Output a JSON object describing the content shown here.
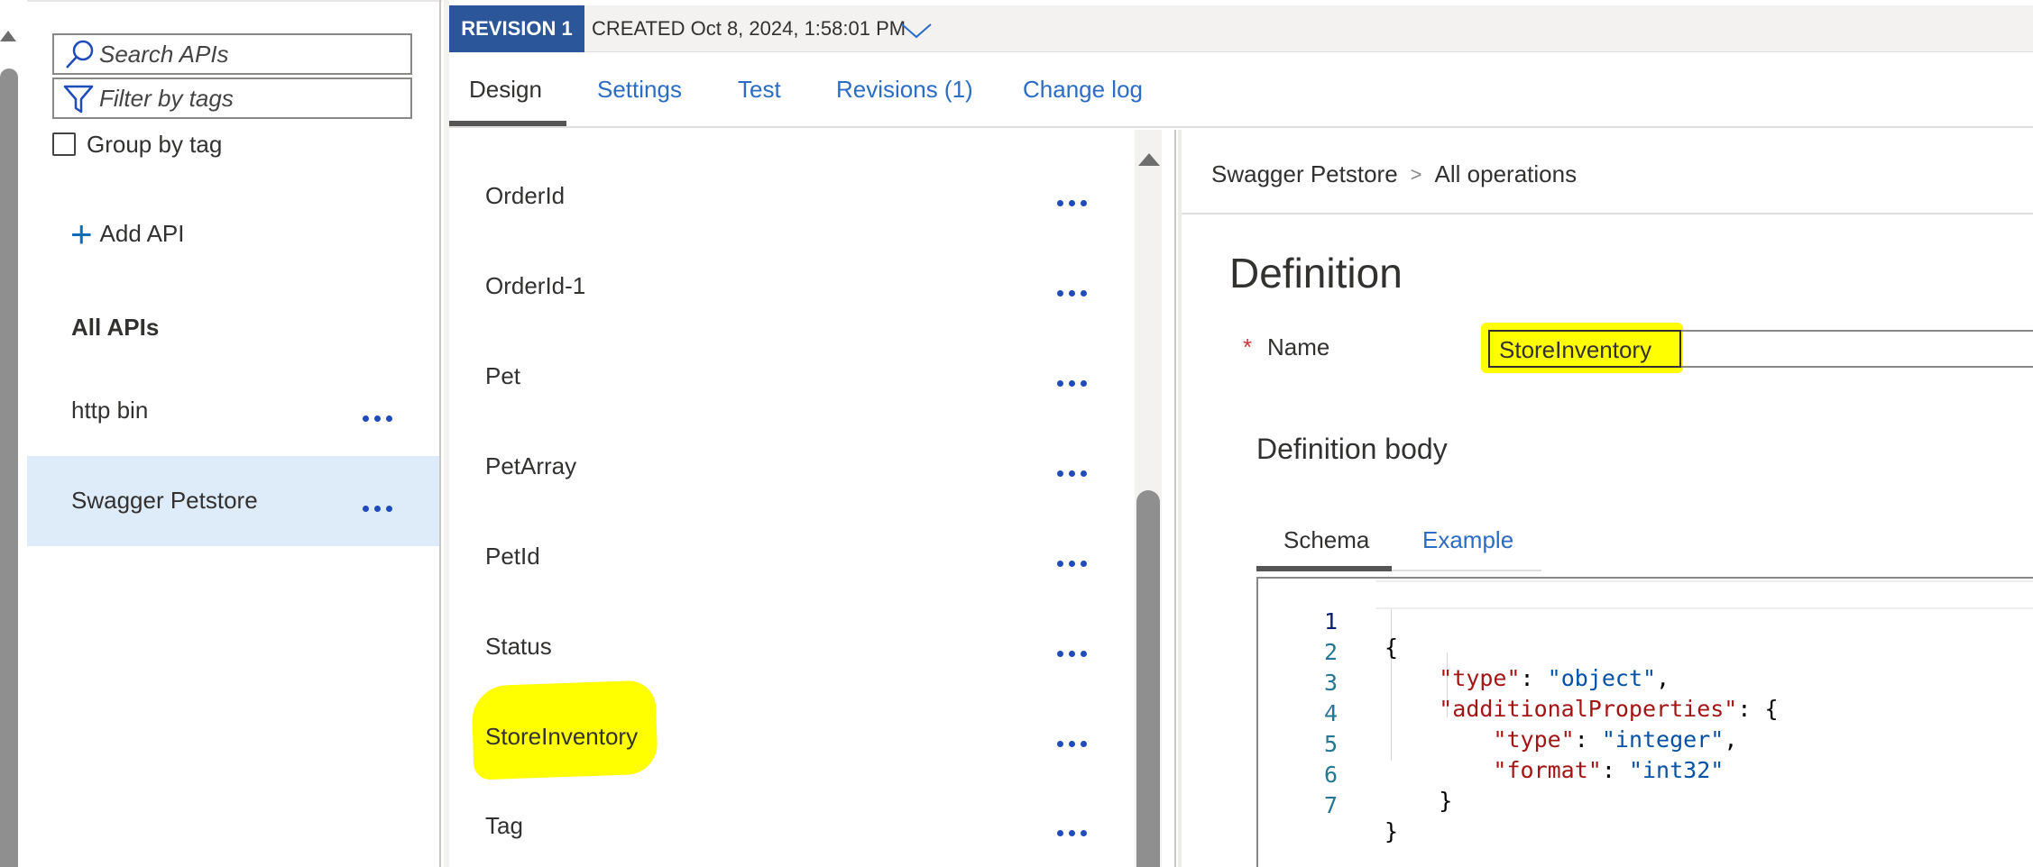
{
  "sidebar": {
    "search_placeholder": "Search APIs",
    "filter_placeholder": "Filter by tags",
    "group_by_tag_label": "Group by tag",
    "add_api_label": "Add API",
    "all_apis_label": "All APIs",
    "apis": [
      {
        "label": "http bin",
        "selected": false
      },
      {
        "label": "Swagger Petstore",
        "selected": true
      }
    ]
  },
  "header": {
    "revision_label": "REVISION 1",
    "created_text": "CREATED Oct 8, 2024, 1:58:01 PM"
  },
  "tabs": [
    {
      "label": "Design",
      "active": true
    },
    {
      "label": "Settings"
    },
    {
      "label": "Test"
    },
    {
      "label": "Revisions (1)"
    },
    {
      "label": "Change log"
    }
  ],
  "definitions": [
    "OrderId",
    "OrderId-1",
    "Pet",
    "PetArray",
    "PetId",
    "Status",
    "StoreInventory",
    "Tag"
  ],
  "definitions_highlighted": "StoreInventory",
  "breadcrumb": {
    "api": "Swagger Petstore",
    "separator": ">",
    "current": "All operations"
  },
  "definition": {
    "title": "Definition",
    "required_marker": "*",
    "name_label": "Name",
    "name_value": "StoreInventory",
    "body_title": "Definition body",
    "subtabs": [
      {
        "label": "Schema",
        "active": true
      },
      {
        "label": "Example"
      }
    ],
    "code_lines": [
      {
        "n": "1",
        "text": "{"
      },
      {
        "n": "2",
        "text": "    \"type\": \"object\","
      },
      {
        "n": "3",
        "text": "    \"additionalProperties\": {"
      },
      {
        "n": "4",
        "text": "        \"type\": \"integer\","
      },
      {
        "n": "5",
        "text": "        \"format\": \"int32\""
      },
      {
        "n": "6",
        "text": "    }"
      },
      {
        "n": "7",
        "text": "}"
      }
    ]
  },
  "colors": {
    "accent": "#2b579a",
    "link": "#2b6cc4",
    "highlight": "#ffff00",
    "selected_bg": "#deecf9",
    "dots": "#1f4bbb"
  },
  "icons": {
    "search": "search-icon",
    "filter": "filter-icon",
    "add": "plus-icon",
    "more": "more-dots-icon",
    "chevron": "chevron-down-icon"
  }
}
